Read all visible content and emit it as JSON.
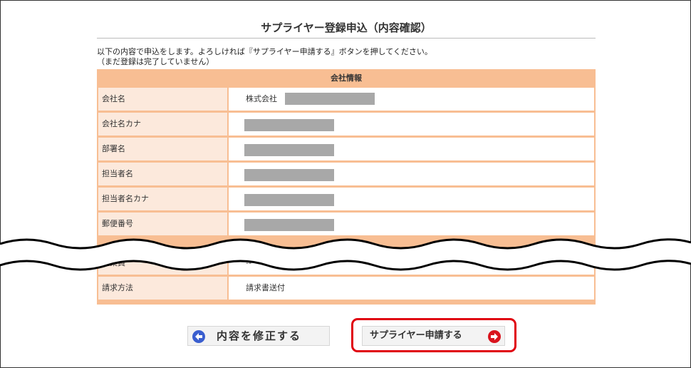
{
  "page": {
    "title": "サプライヤー登録申込（内容確認）",
    "intro_line1": "以下の内容で申込をします。よろしければ『サプライヤー申請する』ボタンを押してください。",
    "intro_line2": "（まだ登録は完了していません）"
  },
  "company_info": {
    "header": "会社情報",
    "rows": [
      {
        "label": "会社名",
        "value": "株式会社"
      },
      {
        "label": "会社名カナ",
        "value": ""
      },
      {
        "label": "部署名",
        "value": ""
      },
      {
        "label": "担当者名",
        "value": ""
      },
      {
        "label": "担当者名カナ",
        "value": ""
      },
      {
        "label": "郵便番号",
        "value": ""
      },
      {
        "label": "従業員",
        "value": "--"
      },
      {
        "label": "請求方法",
        "value": "請求書送付"
      }
    ]
  },
  "buttons": {
    "back_label": "内容を修正する",
    "apply_label": "サプライヤー申請する"
  },
  "colors": {
    "table_border": "#f8be93",
    "label_bg": "#fce9dc",
    "back_icon": "#3a5ecf",
    "apply_icon": "#d9141e",
    "highlight": "#e0000e"
  },
  "icons": {
    "back": "arrow-left-circle-icon",
    "apply": "arrow-right-circle-icon"
  }
}
